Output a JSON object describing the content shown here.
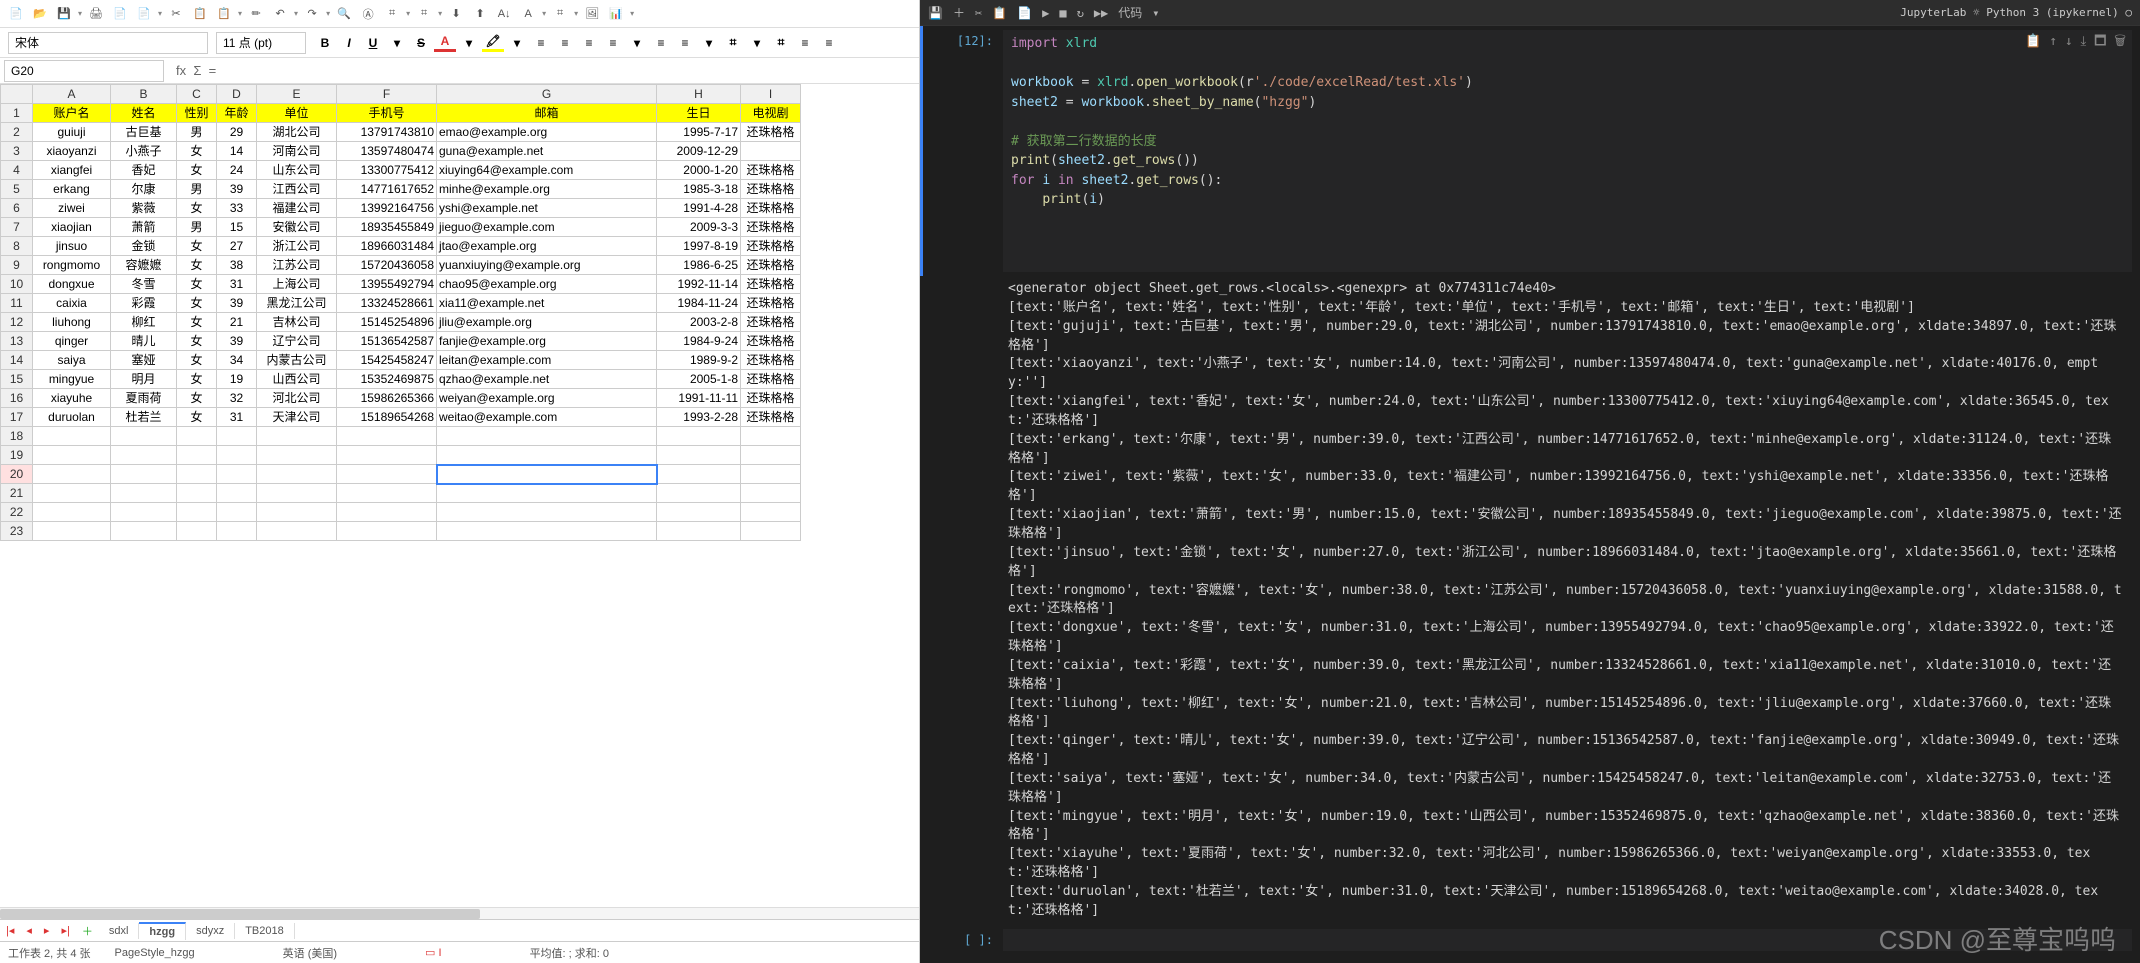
{
  "calc": {
    "fontname": "宋体",
    "fontsize": "11 点 (pt)",
    "cellref": "G20",
    "cols": [
      "A",
      "B",
      "C",
      "D",
      "E",
      "F",
      "G",
      "H",
      "I"
    ],
    "header": [
      "账户名",
      "姓名",
      "性别",
      "年龄",
      "单位",
      "手机号",
      "邮箱",
      "生日",
      "电视剧"
    ],
    "rows": [
      [
        "guiuji",
        "古巨基",
        "男",
        "29",
        "湖北公司",
        "13791743810",
        "emao@example.org",
        "1995-7-17",
        "还珠格格"
      ],
      [
        "xiaoyanzi",
        "小燕子",
        "女",
        "14",
        "河南公司",
        "13597480474",
        "guna@example.net",
        "2009-12-29",
        ""
      ],
      [
        "xiangfei",
        "香妃",
        "女",
        "24",
        "山东公司",
        "13300775412",
        "xiuying64@example.com",
        "2000-1-20",
        "还珠格格"
      ],
      [
        "erkang",
        "尔康",
        "男",
        "39",
        "江西公司",
        "14771617652",
        "minhe@example.org",
        "1985-3-18",
        "还珠格格"
      ],
      [
        "ziwei",
        "紫薇",
        "女",
        "33",
        "福建公司",
        "13992164756",
        "yshi@example.net",
        "1991-4-28",
        "还珠格格"
      ],
      [
        "xiaojian",
        "萧箭",
        "男",
        "15",
        "安徽公司",
        "18935455849",
        "jieguo@example.com",
        "2009-3-3",
        "还珠格格"
      ],
      [
        "jinsuo",
        "金锁",
        "女",
        "27",
        "浙江公司",
        "18966031484",
        "jtao@example.org",
        "1997-8-19",
        "还珠格格"
      ],
      [
        "rongmomo",
        "容嬷嬷",
        "女",
        "38",
        "江苏公司",
        "15720436058",
        "yuanxiuying@example.org",
        "1986-6-25",
        "还珠格格"
      ],
      [
        "dongxue",
        "冬雪",
        "女",
        "31",
        "上海公司",
        "13955492794",
        "chao95@example.org",
        "1992-11-14",
        "还珠格格"
      ],
      [
        "caixia",
        "彩霞",
        "女",
        "39",
        "黑龙江公司",
        "13324528661",
        "xia11@example.net",
        "1984-11-24",
        "还珠格格"
      ],
      [
        "liuhong",
        "柳红",
        "女",
        "21",
        "吉林公司",
        "15145254896",
        "jliu@example.org",
        "2003-2-8",
        "还珠格格"
      ],
      [
        "qinger",
        "晴儿",
        "女",
        "39",
        "辽宁公司",
        "15136542587",
        "fanjie@example.org",
        "1984-9-24",
        "还珠格格"
      ],
      [
        "saiya",
        "塞娅",
        "女",
        "34",
        "内蒙古公司",
        "15425458247",
        "leitan@example.com",
        "1989-9-2",
        "还珠格格"
      ],
      [
        "mingyue",
        "明月",
        "女",
        "19",
        "山西公司",
        "15352469875",
        "qzhao@example.net",
        "2005-1-8",
        "还珠格格"
      ],
      [
        "xiayuhe",
        "夏雨荷",
        "女",
        "32",
        "河北公司",
        "15986265366",
        "weiyan@example.org",
        "1991-11-11",
        "还珠格格"
      ],
      [
        "duruolan",
        "杜若兰",
        "女",
        "31",
        "天津公司",
        "15189654268",
        "weitao@example.com",
        "1993-2-28",
        "还珠格格"
      ]
    ],
    "emptyrows": [
      "18",
      "19",
      "20",
      "21",
      "22",
      "23"
    ],
    "tabs": [
      "sdxl",
      "hzgg",
      "sdyxz",
      "TB2018"
    ],
    "activetab": 1,
    "status_sheet": "工作表 2, 共 4 张",
    "status_style": "PageStyle_hzgg",
    "status_lang": "英语 (美国)",
    "status_avg": "平均值: ; 求和: 0"
  },
  "jupyter": {
    "runlabel": "代码",
    "top_right": "JupyterLab ☼   Python 3 (ipykernel) ○",
    "prompt": "[12]:",
    "prompt2": "[ ]:",
    "code_lines": [
      [
        [
          "kw",
          "import"
        ],
        [
          "",
          ""
        ],
        [
          "mod",
          " xlrd"
        ]
      ],
      [
        [
          "",
          ""
        ]
      ],
      [
        [
          "var",
          "workbook"
        ],
        [
          "",
          " = "
        ],
        [
          "mod",
          "xlrd"
        ],
        [
          "",
          "."
        ],
        [
          "fn",
          "open_workbook"
        ],
        [
          "",
          "(r"
        ],
        [
          "str",
          "'./code/excelRead/test.xls'"
        ],
        [
          "",
          ")"
        ]
      ],
      [
        [
          "var",
          "sheet2"
        ],
        [
          "",
          " = "
        ],
        [
          "var",
          "workbook"
        ],
        [
          "",
          "."
        ],
        [
          "fn",
          "sheet_by_name"
        ],
        [
          "",
          "("
        ],
        [
          "str",
          "\"hzgg\""
        ],
        [
          "",
          ")"
        ]
      ],
      [
        [
          "",
          ""
        ]
      ],
      [
        [
          "cmt",
          "# 获取第二行数据的长度"
        ]
      ],
      [
        [
          "fn",
          "print"
        ],
        [
          "",
          "("
        ],
        [
          "var",
          "sheet2"
        ],
        [
          "",
          "."
        ],
        [
          "fn",
          "get_rows"
        ],
        [
          "",
          "())"
        ]
      ],
      [
        [
          "kw",
          "for"
        ],
        [
          "",
          " "
        ],
        [
          "var",
          "i"
        ],
        [
          "",
          " "
        ],
        [
          "kw",
          "in"
        ],
        [
          "",
          " "
        ],
        [
          "var",
          "sheet2"
        ],
        [
          "",
          "."
        ],
        [
          "fn",
          "get_rows"
        ],
        [
          "",
          "():"
        ]
      ],
      [
        [
          "",
          "    "
        ],
        [
          "fn",
          "print"
        ],
        [
          "",
          "("
        ],
        [
          "var",
          "i"
        ],
        [
          "",
          ")"
        ]
      ]
    ],
    "output": [
      "<generator object Sheet.get_rows.<locals>.<genexpr> at 0x774311c74e40>",
      "[text:'账户名', text:'姓名', text:'性别', text:'年龄', text:'单位', text:'手机号', text:'邮箱', text:'生日', text:'电视剧']",
      "[text:'gujuji', text:'古巨基', text:'男', number:29.0, text:'湖北公司', number:13791743810.0, text:'emao@example.org', xldate:34897.0, text:'还珠格格']",
      "[text:'xiaoyanzi', text:'小燕子', text:'女', number:14.0, text:'河南公司', number:13597480474.0, text:'guna@example.net', xldate:40176.0, empty:'']",
      "[text:'xiangfei', text:'香妃', text:'女', number:24.0, text:'山东公司', number:13300775412.0, text:'xiuying64@example.com', xldate:36545.0, text:'还珠格格']",
      "[text:'erkang', text:'尔康', text:'男', number:39.0, text:'江西公司', number:14771617652.0, text:'minhe@example.org', xldate:31124.0, text:'还珠格格']",
      "[text:'ziwei', text:'紫薇', text:'女', number:33.0, text:'福建公司', number:13992164756.0, text:'yshi@example.net', xldate:33356.0, text:'还珠格格']",
      "[text:'xiaojian', text:'萧箭', text:'男', number:15.0, text:'安徽公司', number:18935455849.0, text:'jieguo@example.com', xldate:39875.0, text:'还珠格格']",
      "[text:'jinsuo', text:'金锁', text:'女', number:27.0, text:'浙江公司', number:18966031484.0, text:'jtao@example.org', xldate:35661.0, text:'还珠格格']",
      "[text:'rongmomo', text:'容嬷嬷', text:'女', number:38.0, text:'江苏公司', number:15720436058.0, text:'yuanxiuying@example.org', xldate:31588.0, text:'还珠格格']",
      "[text:'dongxue', text:'冬雪', text:'女', number:31.0, text:'上海公司', number:13955492794.0, text:'chao95@example.org', xldate:33922.0, text:'还珠格格']",
      "[text:'caixia', text:'彩霞', text:'女', number:39.0, text:'黑龙江公司', number:13324528661.0, text:'xia11@example.net', xldate:31010.0, text:'还珠格格']",
      "[text:'liuhong', text:'柳红', text:'女', number:21.0, text:'吉林公司', number:15145254896.0, text:'jliu@example.org', xldate:37660.0, text:'还珠格格']",
      "[text:'qinger', text:'晴儿', text:'女', number:39.0, text:'辽宁公司', number:15136542587.0, text:'fanjie@example.org', xldate:30949.0, text:'还珠格格']",
      "[text:'saiya', text:'塞娅', text:'女', number:34.0, text:'内蒙古公司', number:15425458247.0, text:'leitan@example.com', xldate:32753.0, text:'还珠格格']",
      "[text:'mingyue', text:'明月', text:'女', number:19.0, text:'山西公司', number:15352469875.0, text:'qzhao@example.net', xldate:38360.0, text:'还珠格格']",
      "[text:'xiayuhe', text:'夏雨荷', text:'女', number:32.0, text:'河北公司', number:15986265366.0, text:'weiyan@example.org', xldate:33553.0, text:'还珠格格']",
      "[text:'duruolan', text:'杜若兰', text:'女', number:31.0, text:'天津公司', number:15189654268.0, text:'weitao@example.com', xldate:34028.0, text:'还珠格格']"
    ]
  },
  "tb_icons": [
    "📄",
    "📂",
    "💾",
    "▾",
    "🖨",
    "📄",
    "📄",
    "▾",
    "✂",
    "📋",
    "📋",
    "▾",
    "✏",
    "↶",
    "▾",
    "↷",
    "▾",
    "🔍",
    "Ⓐ",
    "⌗",
    "▾",
    "⌗",
    "▾",
    "⬇",
    "⬆",
    "A↓",
    "A",
    "▾",
    "⌗",
    "▾",
    "🖼",
    "📊",
    "▾"
  ],
  "fmt_icons": [
    "B",
    "I",
    "U",
    "▾",
    "S",
    "A",
    "▾",
    "🖍",
    "▾",
    "≡",
    "≡",
    "≡",
    "≡",
    "▾",
    "≡",
    "≡",
    "▾",
    "⌗",
    "▾",
    "⌗",
    "≡",
    "≡"
  ],
  "watermark": "CSDN @至尊宝呜呜"
}
